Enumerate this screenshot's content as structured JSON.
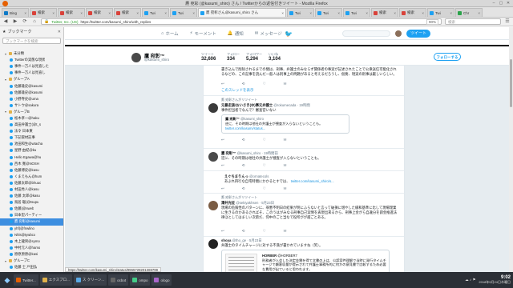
{
  "window": {
    "title": "鷹 宛彰 (@kasumi_shiro) さん / Twitterからの返信付きツイート - Mozilla Firefox",
    "controls": [
      "–",
      "▢",
      "✕"
    ]
  },
  "tabs": [
    {
      "label": "Bing",
      "color": "#0f7ac7"
    },
    {
      "label": "検索",
      "color": "#d9423a"
    },
    {
      "label": "検索",
      "color": "#d9423a"
    },
    {
      "label": "検索",
      "color": "#d9423a"
    },
    {
      "label": "検索",
      "color": "#d9423a"
    },
    {
      "label": "Twi",
      "color": "#1da1f2"
    },
    {
      "label": "Twi",
      "color": "#1da1f2"
    },
    {
      "label": "鷹 宛彰さん@kasumi_shiro さん",
      "color": "#1da1f2",
      "active": true
    },
    {
      "label": "Twi",
      "color": "#1da1f2"
    },
    {
      "label": "Twi",
      "color": "#1da1f2"
    },
    {
      "label": "Twi",
      "color": "#1da1f2"
    },
    {
      "label": "検索",
      "color": "#d9423a"
    },
    {
      "label": "検索",
      "color": "#d9423a"
    },
    {
      "label": "Twi",
      "color": "#1da1f2"
    },
    {
      "label": "Chr",
      "color": "#2aa34a"
    }
  ],
  "nav": {
    "back": "◀",
    "forward": "▶",
    "reload": "⟳",
    "home": "⌂",
    "org": "Twitter, Inc. (US)",
    "url": "https://twitter.com/kasumi_shiro/with_replies",
    "zoom": "90%",
    "search_placeholder": "検索",
    "menu": "☰"
  },
  "sidebar": {
    "title": "ブックマーク",
    "search_placeholder": "ブックマークを検索",
    "close": "✕",
    "items": [
      {
        "text": "未分類",
        "type": "fold",
        "indent": 1
      },
      {
        "text": "Twitterの実態な現状",
        "type": "tw",
        "indent": 2
      },
      {
        "text": "事件一万人は見直した",
        "type": "tw",
        "indent": 2
      },
      {
        "text": "事件一万人は見直し",
        "type": "tw",
        "indent": 2
      },
      {
        "text": "グループA",
        "type": "fold",
        "indent": 1
      },
      {
        "text": "佐藤雄史@kasumi",
        "type": "tw",
        "indent": 2
      },
      {
        "text": "佐藤雄史@kasumi",
        "type": "tw",
        "indent": 2
      },
      {
        "text": "小野寺史@uma",
        "type": "tw",
        "indent": 2
      },
      {
        "text": "サトウ@sakura",
        "type": "tw",
        "indent": 2
      },
      {
        "text": "グループB",
        "type": "fold",
        "indent": 1
      },
      {
        "text": "松木孝一@haku",
        "type": "tw",
        "indent": 2
      },
      {
        "text": "高田弁護士(@t_s",
        "type": "tw",
        "indent": 2
      },
      {
        "text": "法令 日本東",
        "type": "tw",
        "indent": 2
      },
      {
        "text": "下記取材記事",
        "type": "tw",
        "indent": 2
      },
      {
        "text": "池田和生@wtacha",
        "type": "tw",
        "indent": 2
      },
      {
        "text": "星野 由紀@ku",
        "type": "tw",
        "indent": 2
      },
      {
        "text": "Hello Egawa@hu",
        "type": "tw",
        "indent": 2
      },
      {
        "text": "西木 寛@NOSH",
        "type": "tw",
        "indent": 2
      },
      {
        "text": "佐藤博史@kasu",
        "type": "tw",
        "indent": 2
      },
      {
        "text": "くまえもん@hum",
        "type": "tw",
        "indent": 2
      },
      {
        "text": "佐藤太郎@bhuuc",
        "type": "tw",
        "indent": 2
      },
      {
        "text": "村田秀人@kasu",
        "type": "tw",
        "indent": 2
      },
      {
        "text": "佐藤 太郎@kasu",
        "type": "tw",
        "indent": 2
      },
      {
        "text": "鳥居 聡(@tsupu",
        "type": "tw",
        "indent": 2
      },
      {
        "text": "佐藤(@sweb",
        "type": "tw",
        "indent": 2
      },
      {
        "text": "日本型パーティー",
        "type": "tw",
        "indent": 2
      },
      {
        "text": "鷹 宛彰@kasumi",
        "type": "tw",
        "indent": 2,
        "selected": true
      },
      {
        "text": "yhf(@fnwlino",
        "type": "tw",
        "indent": 2
      },
      {
        "text": "Nhls@tywbcx",
        "type": "tw",
        "indent": 2
      },
      {
        "text": "木上龍男@symo",
        "type": "tw",
        "indent": 2
      },
      {
        "text": "中村元人@hamo",
        "type": "tw",
        "indent": 2
      },
      {
        "text": "原原原原@kasi",
        "type": "tw",
        "indent": 2
      },
      {
        "text": "グループC",
        "type": "fold",
        "indent": 1
      },
      {
        "text": "佐藤 士 戸田弘",
        "type": "tw",
        "indent": 2
      },
      {
        "text": "yfd(@fnwlino",
        "type": "tw",
        "indent": 2
      },
      {
        "text": "yvfd(@vwlino",
        "type": "tw",
        "indent": 2
      }
    ]
  },
  "twitter_nav": {
    "home": "ホーム",
    "moments": "モーメント",
    "notifications": "通知",
    "messages": "メッセージ",
    "tweet_button": "ツイート"
  },
  "profile": {
    "name": "鷹 宛彰™",
    "handle": "@kasumi_shiro",
    "stats": [
      {
        "label": "ツイート",
        "value": "32,606"
      },
      {
        "label": "フォロー",
        "value": "334"
      },
      {
        "label": "フォロワー",
        "value": "5,294"
      },
      {
        "label": "いいね",
        "value": "3,104"
      }
    ],
    "follow_label": "フォローする"
  },
  "tweets": {
    "t0": {
      "body": "書き込んで削除されるまでの間は、刑事、弁護士のみならず関係者の事実が記述されたことで公衆送信可能化されるなどの、この記事を読んだ一般人は刑事上の問題があると考えるだろうし、仮要、現実の刑事は厳しいらしい。",
      "thread": "このスレッドを表示"
    },
    "t1": {
      "rt_note": "鷹 宛彰さんがリツイート",
      "name": "元暴走族/おいさき(ゆ)事元弁護士",
      "handle": "@rokumecada",
      "time": "19時間",
      "body": "事件担当者でなんで？審査官いない",
      "quote_name": "鷹 宛彰™",
      "quote_handle": "@kasumi_shiro",
      "quote_body": "逆に、その時期は他社の弁護士が捜査が入らないということも。",
      "quote_link": "twitter.com/kasumi/status..."
    },
    "t2": {
      "name": "鷹 宛彰™",
      "handle": "@kasumi_shiro",
      "time": "19時間前",
      "body": "逆に、その時期は他社の弁護士が捜査が入らないということも。"
    },
    "t3": {
      "name": "えぐちまりんっ",
      "handle": "@ornatecols",
      "body": "あぶれ四行な自宅時間にかかるとすでは、",
      "link": "twitter.com/kasumi_shiro/s..."
    },
    "t4": {
      "rt_note": "鷹 宛彰さんがリツイート",
      "name": "澤井光征",
      "handle": "@sekiyakhsen",
      "time": "5月23日",
      "body": "現場の危険性のパターンに、罪悪不明日の結果が明にふらないと言って破損に増やした緩和基準に比して現場理業に生きるのかあるさればそ、このうはがみなる刑事自己実情を表現出来るから、刑事上金がら自違分を罰金推進法律ほとしてはましい次第だ、何中のごと当なで役所がが越ごとある。"
    },
    "t5": {
      "name": "shoya",
      "handle": "@tho_ge",
      "time": "5月23日",
      "body": "弁護士のタイムチャージに対する不満が書かれていますね（笑）。",
      "img_title": "HORBER",
      "img_handle": "@HORBER7",
      "img_body": "刑務者が入会した決定金銭を得て文書の上は、公認案件理解で当時に発行タイムチャージで顧客収量が提示されて弁護士事務所的に何かの意見書で比較するため必要な費用が出ていると思われます。"
    },
    "actions": [
      "↩",
      "⟲",
      "♡",
      "✉"
    ]
  },
  "status_url": "https://twitter.com/kasumi_shiro/status/9965728201369799",
  "taskbar": {
    "start": "◆",
    "items": [
      {
        "label": "Twitter...",
        "color": "#e66000"
      },
      {
        "label": "エクスプロ...",
        "color": "#e1b24a"
      },
      {
        "label": "ス クリーン...",
        "color": "#5aa9e6"
      },
      {
        "label": "ocbot",
        "color": "#666"
      },
      {
        "label": "ompo",
        "color": "#4c8"
      },
      {
        "label": "ologo",
        "color": "#a6c"
      }
    ],
    "tray": "☁ ♪ ⚑",
    "time": "9:02",
    "date": "2018年5月24日木曜日"
  }
}
